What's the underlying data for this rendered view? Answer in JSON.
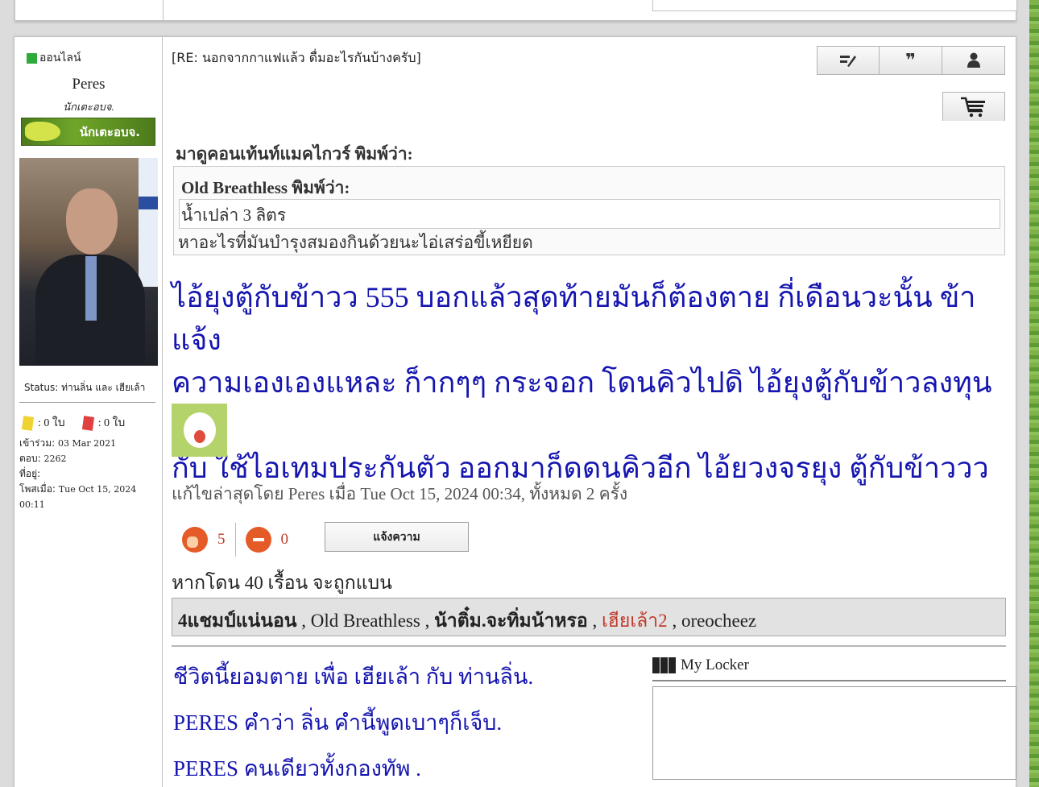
{
  "post": {
    "profile": {
      "online_label": "ออนไลน์",
      "username": "Peres",
      "user_title": "นักเตะอบจ.",
      "rank_badge_text": "นักเตะอบจ.",
      "status": "Status: ท่านลิ่น และ เฮียเล้า",
      "yellow_cards": ": 0 ใบ",
      "red_cards": ": 0 ใบ",
      "joined_label": "เข้าร่วม:",
      "joined_value": "03 Mar 2021",
      "replies_label": "ตอบ:",
      "replies_value": "2262",
      "location_label": "ที่อยู่:",
      "location_value": "",
      "posted_label": "โพสเมื่อ:",
      "posted_value": "Tue Oct 15, 2024 00:11"
    },
    "subject": "[RE: นอกจากกาแฟแล้ว ดื่มอะไรกันบ้างครับ]",
    "buttons": {
      "edit_icon": "edit-icon",
      "quote_icon": "quote-icon",
      "user_icon": "user-icon",
      "cart_icon": "cart-icon"
    },
    "quote": {
      "outer_author": "มาดูคอนเท้นท์แมคไกวร์ พิมพ์ว่า:",
      "inner_author": "Old Breathless พิมพ์ว่า:",
      "inner_text": "น้ำเปล่า 3 ลิตร",
      "outer_text": "หาอะไรที่มันบำรุงสมองกินด้วยนะไอ่เสร่อขี้เหยียด"
    },
    "body_lines": [
      "ไอ้ยุงตู้กับข้าวว 555 บอกแล้วสุดท้ายมันก็ต้องตาย กี่เดือนวะนั้น ข้าแจ้ง",
      "ความเองเองแหละ ก็ากๆๆ กระจอก โดนคิวไปดิ ไอ้ยุงตู้กับข้าวลงทุนถึง",
      "กับ ใช้ไอเทมประกันตัว ออกมาก็ดดนคิวอีก ไอ้ยวงจรยุง ตู้กับข้าววว"
    ],
    "edited_note": "แก้ไขล่าสุดโดย Peres เมื่อ Tue Oct 15, 2024 00:34, ทั้งหมด 2 ครั้ง",
    "reactions": {
      "like_count": "5",
      "dislike_count": "0"
    },
    "report_label": "แจ้งความ",
    "warning_text": "หากโดน 40 เรื้อน จะถูกแบน",
    "likers": [
      {
        "name": "4แชมป์แน่นอน",
        "style": "bold"
      },
      {
        "name": "Old Breathless",
        "style": "normal"
      },
      {
        "name": "น้าติ๋ม.จะทิ่มน้าหรอ",
        "style": "bold"
      },
      {
        "name": "เฮียเล้า2",
        "style": "red"
      },
      {
        "name": "oreocheez",
        "style": "normal"
      }
    ],
    "likers_separator": " , ",
    "signature": [
      "ชีวิตนี้ยอมตาย เพื่อ เฮียเล้า กับ ท่านลิ่น.",
      "PERES คำว่า ลิ่น คำนี้พูดเบาๆก็เจ็บ.",
      "PERES คนเดียวทั้งกองทัพ ."
    ],
    "locker_title": "My Locker"
  },
  "colors": {
    "link_blue": "#1515b0",
    "online_green": "#2eaa3a",
    "red_name": "#c0392b"
  }
}
